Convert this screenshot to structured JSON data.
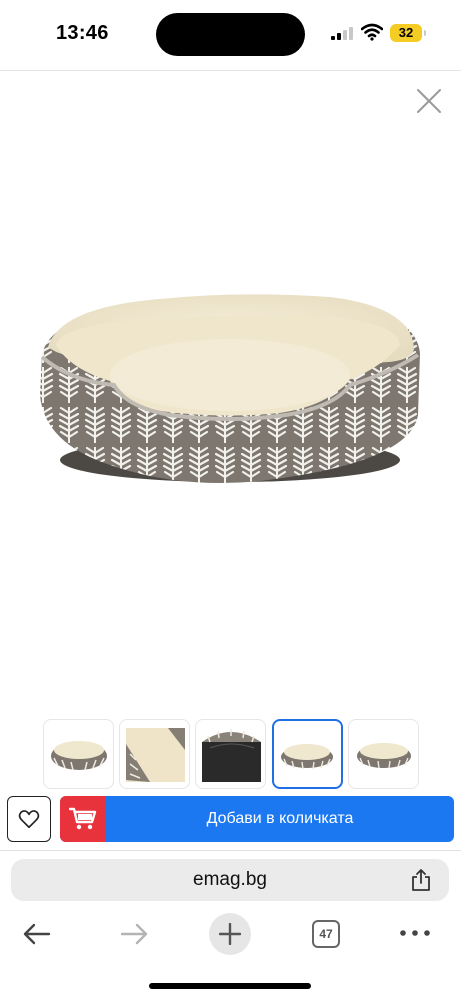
{
  "status_bar": {
    "time": "13:46",
    "battery_level": "32",
    "icons": [
      "signal-icon",
      "wifi-icon",
      "battery-icon"
    ],
    "battery_color": "#f5cc23"
  },
  "viewer": {
    "close_icon": "close-icon",
    "main_image": "dog-bed-image",
    "thumbnails": [
      {
        "name": "thumb-bed-front",
        "selected": false
      },
      {
        "name": "thumb-bed-closeup",
        "selected": false
      },
      {
        "name": "thumb-bed-bottom",
        "selected": false
      },
      {
        "name": "thumb-bed-side",
        "selected": true
      },
      {
        "name": "thumb-bed-angle",
        "selected": false
      }
    ],
    "selected_border_color": "#1f6fe5"
  },
  "actions": {
    "favorite_icon": "heart-icon",
    "cart_icon": "cart-icon",
    "add_to_cart_label": "Добави в количката",
    "add_to_cart_color": "#1c78f0",
    "cart_block_color": "#e8323c"
  },
  "browser": {
    "address": "emag.bg",
    "share_icon": "share-icon",
    "tabs_count": "47",
    "toolbar_icons": [
      "back-arrow-icon",
      "forward-arrow-icon",
      "plus-icon",
      "tabs-icon",
      "more-icon"
    ]
  }
}
